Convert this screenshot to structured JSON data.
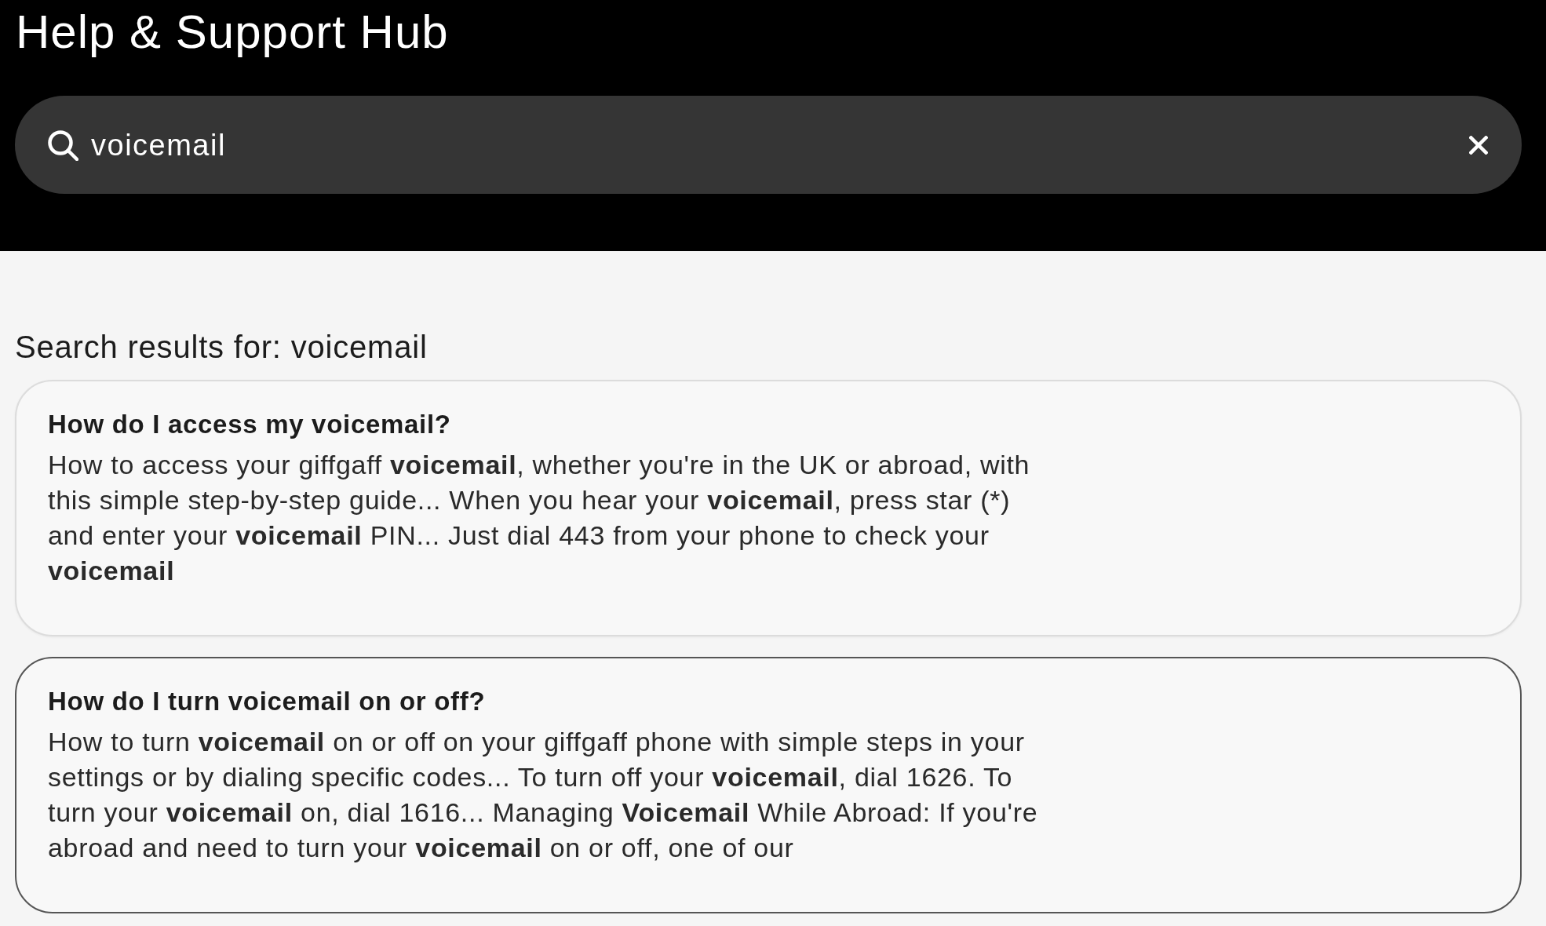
{
  "header": {
    "title": "Help & Support Hub"
  },
  "search": {
    "value": "voicemail"
  },
  "results_heading": "Search results for: voicemail",
  "results": [
    {
      "title": "How do I access my voicemail?",
      "snippet": "How to access your giffgaff **voicemail**, whether you're in the UK or abroad, with this simple step-by-step guide... When you hear your **voicemail**, press star (*) and enter your **voicemail** PIN... Just dial 443 from your phone to check your **voicemail**",
      "selected": false
    },
    {
      "title": "How do I turn voicemail on or off?",
      "snippet": "How to turn **voicemail** on or off on your giffgaff phone with simple steps in your settings or by dialing specific codes... To turn off your **voicemail**, dial 1626. To turn your **voicemail** on, dial 1616... Managing **Voicemail** While Abroad: If you're abroad and need to turn your **voicemail** on or off, one of our",
      "selected": true
    }
  ]
}
